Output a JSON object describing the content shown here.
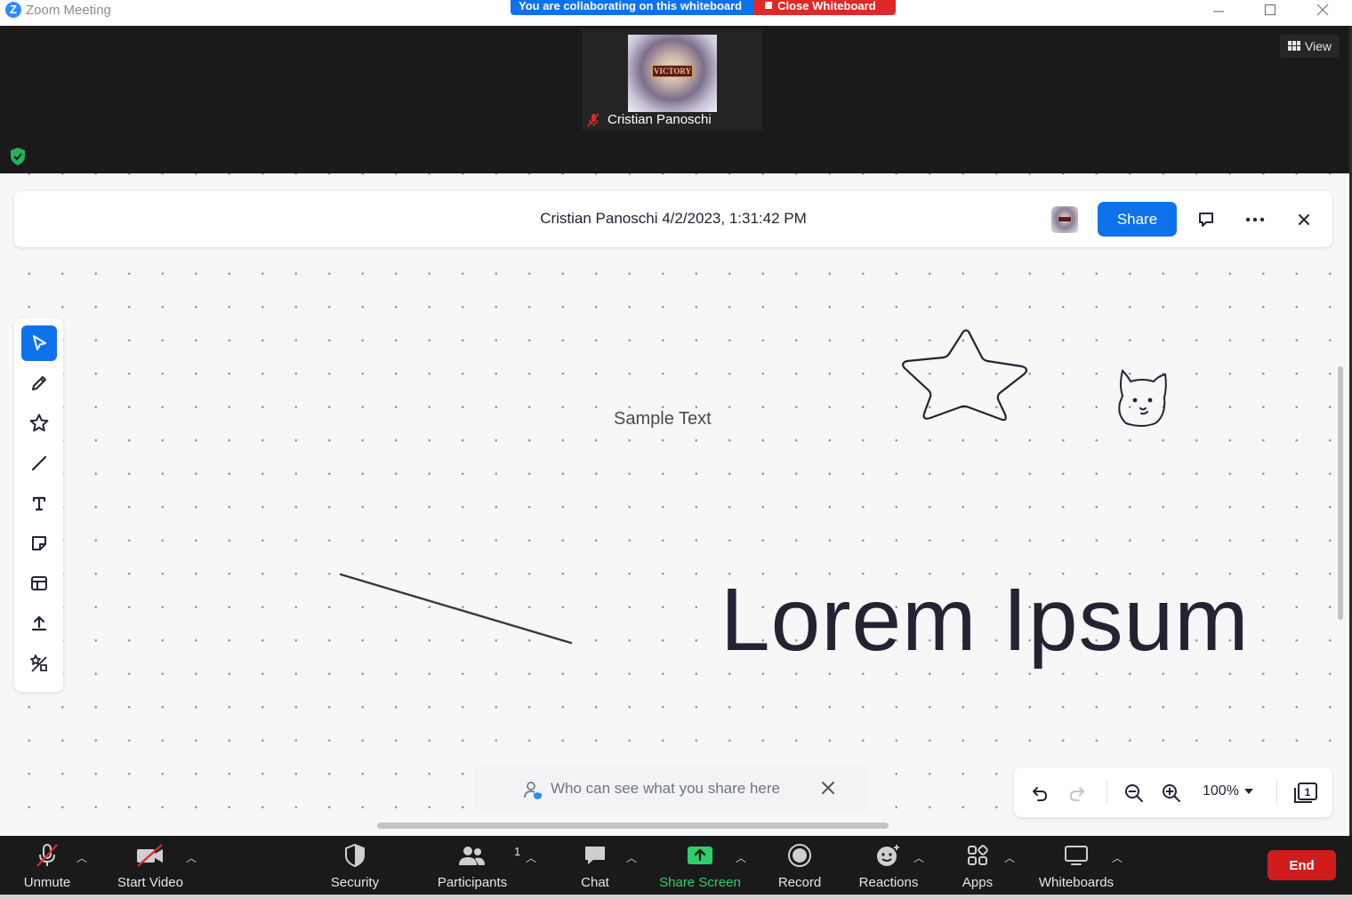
{
  "window": {
    "app_title": "Zoom Meeting",
    "logo_letter": "Z",
    "minimize_glyph": "—",
    "maximize_glyph": "☐",
    "close_glyph": "✕"
  },
  "banner": {
    "collab_text": "You are collaborating on this whiteboard",
    "close_label": "Close Whiteboard"
  },
  "participant": {
    "name": "Cristian Panoschi",
    "avatar_text": "VICTORY",
    "muted": true
  },
  "view_button": {
    "label": "View"
  },
  "whiteboard": {
    "title": "Cristian Panoschi 4/2/2023, 1:31:42 PM",
    "share_label": "Share",
    "tools": [
      {
        "name": "select-tool",
        "icon": "cursor-icon",
        "active": true
      },
      {
        "name": "pen-tool",
        "icon": "pencil-icon",
        "active": false
      },
      {
        "name": "shapes-tool",
        "icon": "star-icon",
        "active": false
      },
      {
        "name": "line-tool",
        "icon": "line-icon",
        "active": false
      },
      {
        "name": "text-tool",
        "icon": "text-icon",
        "active": false
      },
      {
        "name": "sticky-note-tool",
        "icon": "sticky-note-icon",
        "active": false
      },
      {
        "name": "template-tool",
        "icon": "template-icon",
        "active": false
      },
      {
        "name": "upload-tool",
        "icon": "upload-icon",
        "active": false
      },
      {
        "name": "more-shapes-tool",
        "icon": "shapes-icon",
        "active": false
      }
    ],
    "canvas": {
      "sample_text": "Sample Text",
      "lorem_text": "Lorem Ipsum"
    },
    "share_notice": "Who can see what you share here",
    "zoom_level": "100%",
    "page_count": "1"
  },
  "bottombar": {
    "unmute": "Unmute",
    "start_video": "Start Video",
    "security": "Security",
    "participants": "Participants",
    "participants_count": "1",
    "chat": "Chat",
    "share_screen": "Share Screen",
    "record": "Record",
    "reactions": "Reactions",
    "apps": "Apps",
    "whiteboards": "Whiteboards",
    "end": "End"
  },
  "colors": {
    "accent": "#0e72ed",
    "danger": "#e02828",
    "share_green": "#2dcf6c",
    "dark_bg": "#1a1a1a",
    "canvas_bg": "#f7f7f8"
  }
}
